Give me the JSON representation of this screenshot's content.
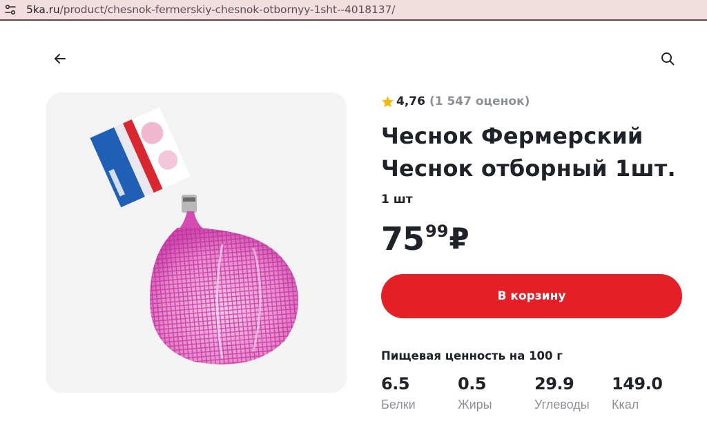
{
  "browser": {
    "url_host": "5ka.ru",
    "url_path": "/product/chesnok-fermerskiy-chesnok-otbornyy-1sht--4018137/"
  },
  "product": {
    "rating": "4,76",
    "rating_count": "(1 547 оценок)",
    "title_line1": "Чеснок Фермерский",
    "title_line2": "Чеснок отборный 1шт.",
    "unit": "1 шт",
    "price_rub": "75",
    "price_kop": "99",
    "currency": "₽",
    "image_icon": "garlic-net-bag-photo"
  },
  "actions": {
    "add_to_cart": "В корзину"
  },
  "nutrition": {
    "title": "Пищевая ценность на 100 г",
    "items": [
      {
        "value": "6.5",
        "label": "Белки"
      },
      {
        "value": "0.5",
        "label": "Жиры"
      },
      {
        "value": "29.9",
        "label": "Углеводы"
      },
      {
        "value": "149.0",
        "label": "Ккал"
      }
    ]
  },
  "colors": {
    "accent_red": "#e41f25",
    "star": "#f5b800",
    "muted": "#8c8f96",
    "address_bar": "#f2dedf"
  }
}
